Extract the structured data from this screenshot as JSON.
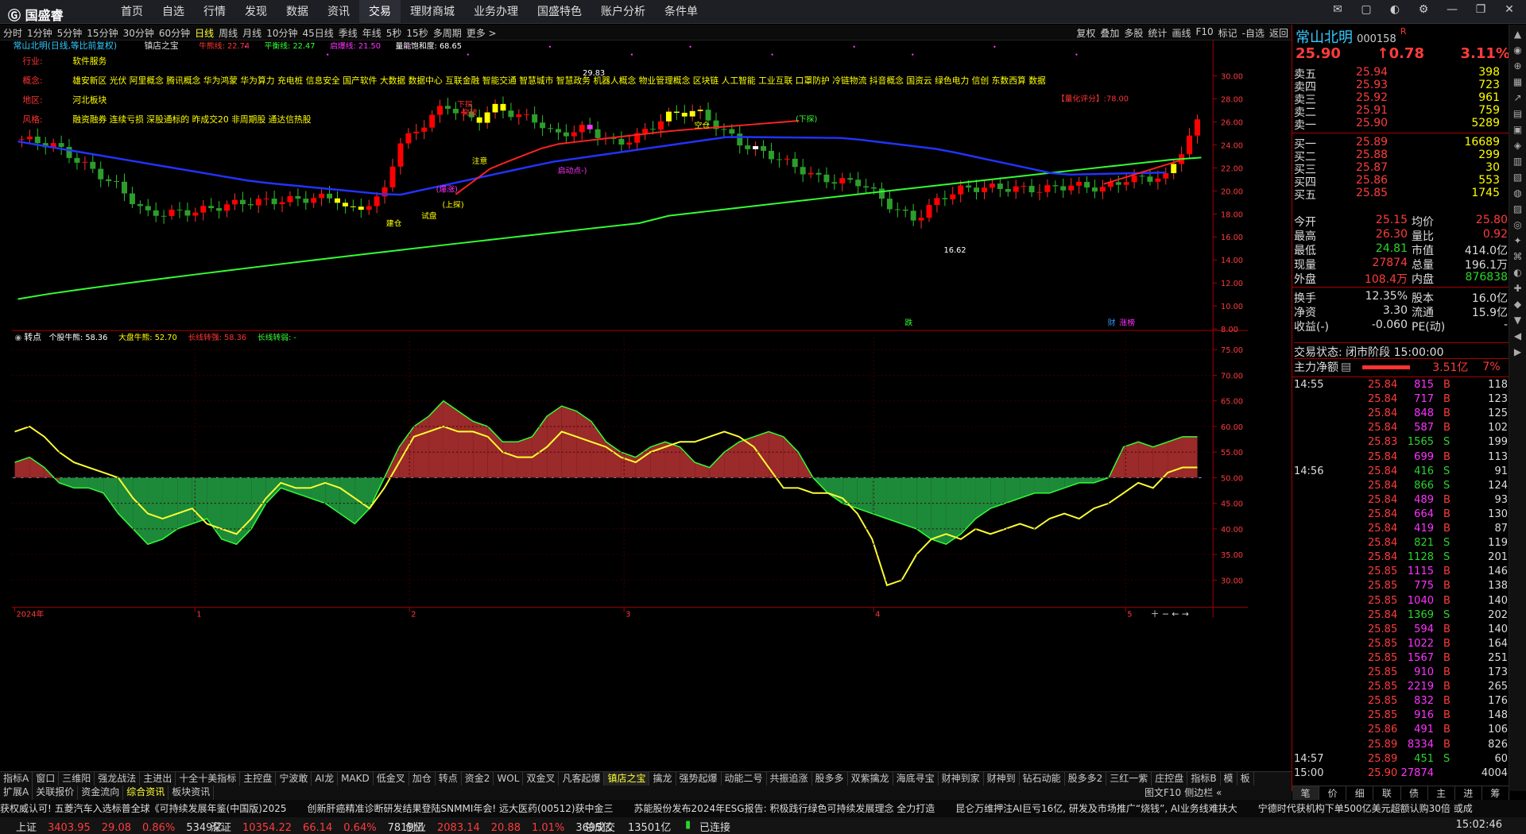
{
  "app": {
    "logo": "国盛睿",
    "menu": [
      "首页",
      "自选",
      "行情",
      "发现",
      "数据",
      "资讯",
      "交易",
      "理财商城",
      "业务办理",
      "国盛特色",
      "账户分析",
      "条件单"
    ],
    "active_menu": "交易"
  },
  "periods": {
    "items": [
      "分时",
      "1分钟",
      "5分钟",
      "15分钟",
      "30分钟",
      "60分钟",
      "日线",
      "周线",
      "月线",
      "10分钟",
      "45日线",
      "季线",
      "年线",
      "5秒",
      "15秒",
      "多周期",
      "更多 >"
    ],
    "active": "日线"
  },
  "tools": [
    "复权",
    "叠加",
    "多股",
    "统计",
    "画线",
    "F10",
    "标记",
    "-自选",
    "返回"
  ],
  "main_chart": {
    "title": "常山北明(日线,等比前复权)",
    "indicator": "镇店之宝",
    "legend": [
      {
        "label": "牛熊线: 22.74",
        "color": "#ff3333"
      },
      {
        "label": "平衡线: 22.47",
        "color": "#33ff33"
      },
      {
        "label": "启爆线: 21.50",
        "color": "#ff33ff"
      },
      {
        "label": "量能饱和度: 68.65",
        "color": "#ffffff"
      }
    ],
    "info_rows": [
      {
        "key": "行业:",
        "value": "软件服务"
      },
      {
        "key": "概念:",
        "value": "雄安新区 光伏 阿里概念 腾讯概念 华为鸿蒙 华为算力 充电桩 信息安全 国产软件 大数据 数据中心 互联金融 智能交通 智慧城市 智慧政务 机器人概念 物业管理概念 区块链 人工智能 工业互联 口罩防护 冷链物流 抖音概念 国资云 绿色电力 信创 东数西算 数据"
      },
      {
        "key": "地区:",
        "value": "河北板块"
      },
      {
        "key": "风格:",
        "value": "融资融券 连续亏损 深股通标的 昨成交20 非周期股 通达信热股"
      }
    ],
    "annotations": [
      "29.83",
      "16.62",
      "下探",
      "突破",
      "注意",
      "启动点-)",
      "试盘",
      "建仓",
      "(上探)",
      "(下探)",
      "空仓",
      "(爆涨)",
      "【量化评分】:78.00",
      "跌",
      "财",
      "涨榜"
    ],
    "y_ticks": [
      "30.00",
      "28.00",
      "26.00",
      "24.00",
      "22.00",
      "20.00",
      "18.00",
      "16.00",
      "14.00",
      "12.00",
      "10.00",
      "8.00"
    ]
  },
  "sub_chart": {
    "title": "转点",
    "legend": [
      {
        "label": "个股牛熊: 58.36",
        "color": "#ffffff"
      },
      {
        "label": "大盘牛熊: 52.70",
        "color": "#ffff00"
      },
      {
        "label": "长线转强: 58.36",
        "color": "#ff3333"
      },
      {
        "label": "长线转弱: -",
        "color": "#33ff33"
      }
    ],
    "y_ticks": [
      "75.00",
      "70.00",
      "65.00",
      "60.00",
      "55.00",
      "50.00",
      "45.00",
      "40.00",
      "35.00",
      "30.00"
    ],
    "x_ticks": [
      "2024年",
      "1",
      "2",
      "3",
      "4",
      "5"
    ]
  },
  "chart_data": [
    {
      "type": "candlestick",
      "title": "常山北明(日线,等比前复权)",
      "ylim": [
        8,
        30
      ],
      "annotated_high": 29.83,
      "annotated_low": 16.62,
      "last_close": 25.9
    },
    {
      "type": "area",
      "title": "转点",
      "ylim": [
        30,
        75
      ],
      "baseline": 50,
      "series": [
        {
          "name": "个股牛熊",
          "values": [
            53,
            54,
            52,
            49,
            48,
            48,
            47,
            43,
            40,
            37,
            38,
            40,
            41,
            42,
            38,
            37,
            40,
            45,
            48,
            47,
            46,
            45,
            43,
            41,
            44,
            50,
            56,
            60,
            62,
            65,
            63,
            61,
            60,
            57,
            57,
            58,
            62,
            64,
            63,
            61,
            57,
            55,
            54,
            56,
            57,
            56,
            53,
            52,
            55,
            57,
            58,
            59,
            58,
            55,
            50,
            47,
            45,
            44,
            43,
            42,
            41,
            40,
            38,
            37,
            39,
            42,
            44,
            45,
            46,
            47,
            47,
            48,
            49,
            49,
            50,
            56,
            57,
            56,
            57,
            58,
            58
          ]
        },
        {
          "name": "大盘牛熊",
          "values": [
            59,
            60,
            58,
            55,
            53,
            52,
            51,
            50,
            46,
            43,
            42,
            43,
            44,
            41,
            40,
            39,
            42,
            46,
            49,
            48,
            48,
            49,
            48,
            46,
            44,
            48,
            53,
            58,
            59,
            60,
            59,
            59,
            58,
            55,
            54,
            54,
            56,
            59,
            58,
            57,
            56,
            54,
            53,
            55,
            56,
            57,
            57,
            58,
            59,
            58,
            56,
            52,
            48,
            48,
            47,
            47,
            46,
            43,
            38,
            29,
            30,
            35,
            38,
            39,
            38,
            40,
            39,
            40,
            41,
            40,
            42,
            43,
            42,
            44,
            45,
            47,
            49,
            48,
            51,
            52,
            52
          ]
        }
      ]
    }
  ],
  "quote": {
    "name": "常山北明",
    "code": "000158",
    "flag": "R",
    "price": "25.90",
    "change": "↑0.78",
    "pct": "3.11%",
    "asks": [
      {
        "l": "卖五",
        "p": "25.94",
        "v": "398"
      },
      {
        "l": "卖四",
        "p": "25.93",
        "v": "723"
      },
      {
        "l": "卖三",
        "p": "25.92",
        "v": "961"
      },
      {
        "l": "卖二",
        "p": "25.91",
        "v": "759"
      },
      {
        "l": "卖一",
        "p": "25.90",
        "v": "5289"
      }
    ],
    "bids": [
      {
        "l": "买一",
        "p": "25.89",
        "v": "16689"
      },
      {
        "l": "买二",
        "p": "25.88",
        "v": "299"
      },
      {
        "l": "买三",
        "p": "25.87",
        "v": "30"
      },
      {
        "l": "买四",
        "p": "25.86",
        "v": "553"
      },
      {
        "l": "买五",
        "p": "25.85",
        "v": "1745"
      }
    ],
    "stats": [
      [
        "今开",
        "25.15",
        "均价",
        "25.80"
      ],
      [
        "最高",
        "26.30",
        "量比",
        "0.92"
      ],
      [
        "最低",
        "24.81",
        "市值",
        "414.0亿"
      ],
      [
        "现量",
        "27874",
        "总量",
        "196.1万"
      ],
      [
        "外盘",
        "108.4万",
        "内盘",
        "876838"
      ],
      [
        "换手",
        "12.35%",
        "股本",
        "16.0亿"
      ],
      [
        "净资",
        "3.30",
        "流通",
        "15.9亿"
      ],
      [
        "收益(-)",
        "-0.060",
        "PE(动)",
        "-"
      ]
    ],
    "trade_state": "交易状态: 闭市阶段 15:00:00",
    "main_flow_label": "主力净额",
    "main_flow_value": "3.51亿",
    "main_flow_pct": "7%"
  },
  "ticks": [
    {
      "t": "14:55",
      "p": "25.84",
      "v": "815",
      "d": "B",
      "n": "118"
    },
    {
      "t": "",
      "p": "25.84",
      "v": "717",
      "d": "B",
      "n": "123"
    },
    {
      "t": "",
      "p": "25.84",
      "v": "848",
      "d": "B",
      "n": "125"
    },
    {
      "t": "",
      "p": "25.84",
      "v": "587",
      "d": "B",
      "n": "102"
    },
    {
      "t": "",
      "p": "25.83",
      "v": "1565",
      "d": "S",
      "n": "199"
    },
    {
      "t": "",
      "p": "25.84",
      "v": "699",
      "d": "B",
      "n": "113"
    },
    {
      "t": "14:56",
      "p": "25.84",
      "v": "416",
      "d": "S",
      "n": "91"
    },
    {
      "t": "",
      "p": "25.84",
      "v": "866",
      "d": "S",
      "n": "124"
    },
    {
      "t": "",
      "p": "25.84",
      "v": "489",
      "d": "B",
      "n": "93"
    },
    {
      "t": "",
      "p": "25.84",
      "v": "664",
      "d": "B",
      "n": "130"
    },
    {
      "t": "",
      "p": "25.84",
      "v": "419",
      "d": "B",
      "n": "87"
    },
    {
      "t": "",
      "p": "25.84",
      "v": "821",
      "d": "S",
      "n": "119"
    },
    {
      "t": "",
      "p": "25.84",
      "v": "1128",
      "d": "S",
      "n": "201"
    },
    {
      "t": "",
      "p": "25.85",
      "v": "1115",
      "d": "B",
      "n": "146"
    },
    {
      "t": "",
      "p": "25.85",
      "v": "775",
      "d": "B",
      "n": "138"
    },
    {
      "t": "",
      "p": "25.85",
      "v": "1040",
      "d": "B",
      "n": "140"
    },
    {
      "t": "",
      "p": "25.84",
      "v": "1369",
      "d": "S",
      "n": "202"
    },
    {
      "t": "",
      "p": "25.85",
      "v": "594",
      "d": "B",
      "n": "140"
    },
    {
      "t": "",
      "p": "25.85",
      "v": "1022",
      "d": "B",
      "n": "164"
    },
    {
      "t": "",
      "p": "25.85",
      "v": "1567",
      "d": "B",
      "n": "251"
    },
    {
      "t": "",
      "p": "25.85",
      "v": "910",
      "d": "B",
      "n": "173"
    },
    {
      "t": "",
      "p": "25.85",
      "v": "2219",
      "d": "B",
      "n": "265"
    },
    {
      "t": "",
      "p": "25.85",
      "v": "832",
      "d": "B",
      "n": "176"
    },
    {
      "t": "",
      "p": "25.85",
      "v": "916",
      "d": "B",
      "n": "148"
    },
    {
      "t": "",
      "p": "25.86",
      "v": "491",
      "d": "B",
      "n": "106"
    },
    {
      "t": "",
      "p": "25.89",
      "v": "8334",
      "d": "B",
      "n": "826"
    },
    {
      "t": "14:57",
      "p": "25.89",
      "v": "451",
      "d": "S",
      "n": "60"
    },
    {
      "t": "15:00",
      "p": "25.90",
      "v": "27874",
      "d": "",
      "n": "4004"
    }
  ],
  "rp_tabs": [
    "笔",
    "价",
    "细",
    "联",
    "债",
    "主",
    "进",
    "筹"
  ],
  "bottom_tabs": [
    "指标A",
    "窗口",
    "三维阳",
    "强龙战法",
    "主进出",
    "十全十美指标",
    "主控盘",
    "宁波敢",
    "AI龙",
    "MAKD",
    "低金叉",
    "加仓",
    "转点",
    "资金2",
    "WOL",
    "双金叉",
    "凡客起爆",
    "镇店之宝",
    "擒龙",
    "强势起爆",
    "动能二号",
    "共振追涨",
    "股多多",
    "双紫擒龙",
    "海底寻宝",
    "财神到家",
    "财神到",
    "钻石动能",
    "股多多2",
    "三红一紫",
    "庄控盘",
    "指标B",
    "模",
    "板"
  ],
  "active_bottom_tab": "镇店之宝",
  "bottom_tabs2": [
    "扩展A",
    "关联报价",
    "资金流向",
    "综合资讯",
    "板块资讯"
  ],
  "right_tabs": [
    "图文F10",
    "侧边栏 «"
  ],
  "ticker_items": [
    "获权威认可! 五菱汽车入选标普全球《可持续发展年鉴(中国版)2025",
    "创新肝癌精准诊断研发结果登陆SNMMI年会! 远大医药(00512)获中金三",
    "苏能股份发布2024年ESG报告: 积极践行绿色可持续发展理念 全力打造",
    "昆仑万维押注AI巨亏16亿, 研发及市场推广“烧钱”, AI业务线难扶大",
    "宁德时代获机构下单500亿美元超额认购30倍 或成"
  ],
  "status": {
    "indices": [
      {
        "name": "上证",
        "val": "3403.95",
        "chg": "29.08",
        "pct": "0.86%",
        "amt": "5349亿"
      },
      {
        "name": "深证",
        "val": "10354.22",
        "chg": "66.14",
        "pct": "0.64%",
        "amt": "7819亿"
      },
      {
        "name": "创业",
        "val": "2083.14",
        "chg": "20.88",
        "pct": "1.01%",
        "amt": "3695亿"
      }
    ],
    "total_label": "总成交",
    "total": "13501亿",
    "conn": "已连接",
    "time": "15:02:46"
  }
}
